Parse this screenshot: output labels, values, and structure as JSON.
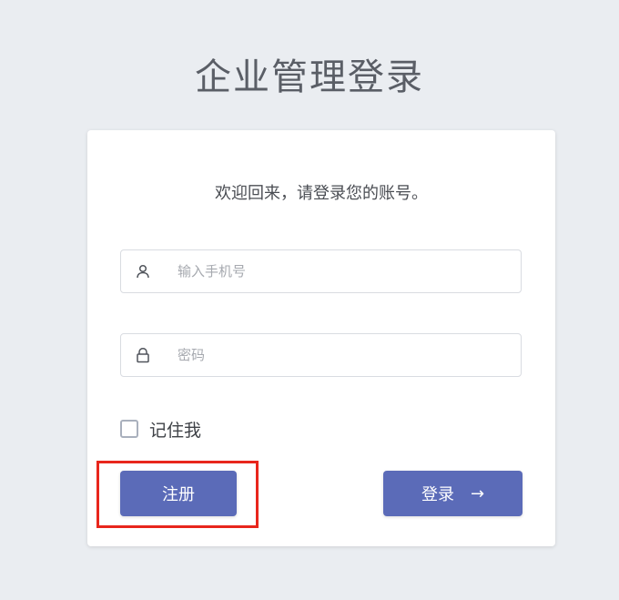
{
  "page": {
    "title": "企业管理登录"
  },
  "card": {
    "welcome": "欢迎回来，请登录您的账号。",
    "phone_placeholder": "输入手机号",
    "password_placeholder": "密码",
    "remember_label": "记住我",
    "remember_checked": false,
    "register_label": "注册",
    "login_label": "登录",
    "login_arrow": "→"
  },
  "icons": {
    "phone_field": "user-icon",
    "password_field": "lock-icon"
  },
  "colors": {
    "background": "#eaedf1",
    "primary_button": "#5b6bb8",
    "highlight_box": "#e8261c"
  }
}
